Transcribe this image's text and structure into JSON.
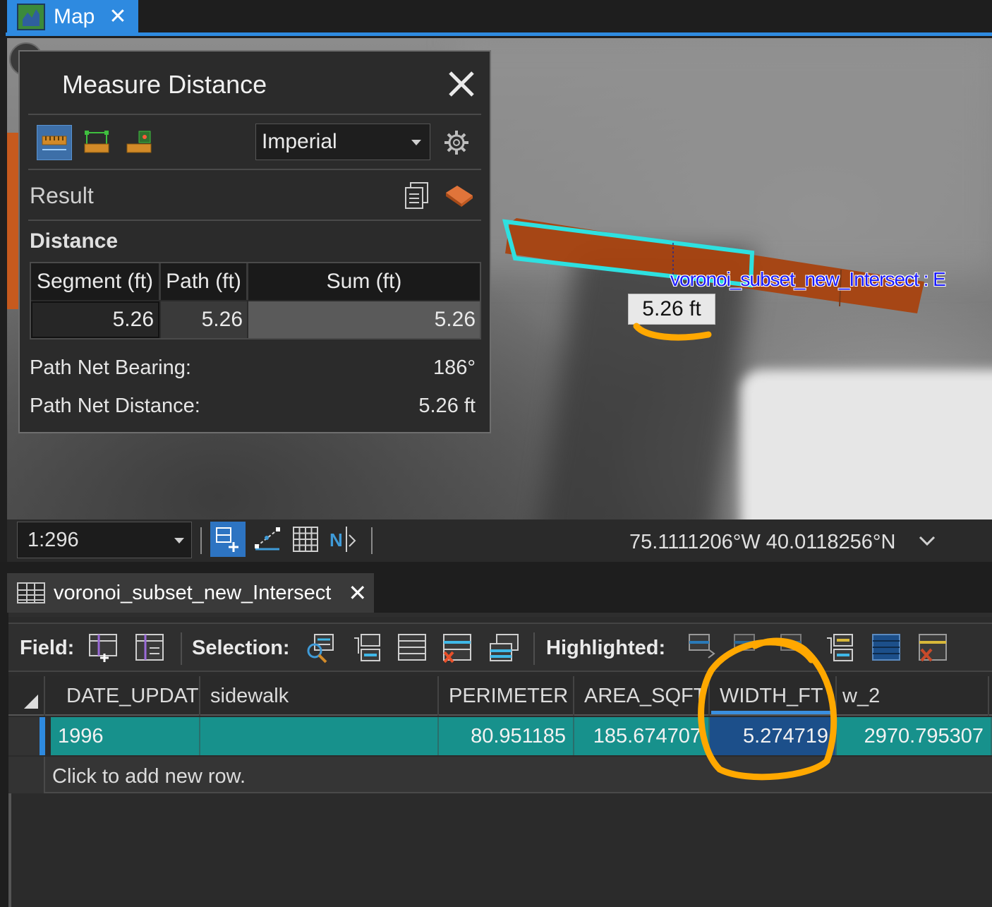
{
  "map_tab": {
    "label": "Map",
    "close": "✕"
  },
  "map": {
    "layer_label": "voronoi_subset_new_Intersect : E",
    "measure_label": "5.26 ft"
  },
  "measure_panel": {
    "title": "Measure Distance",
    "unit_select": "Imperial",
    "result_label": "Result",
    "distance_label": "Distance",
    "table": {
      "headers": [
        "Segment (ft)",
        "Path (ft)",
        "Sum (ft)"
      ],
      "values": [
        "5.26",
        "5.26",
        "5.26"
      ]
    },
    "path_net_bearing": {
      "label": "Path Net Bearing:",
      "value": "186°"
    },
    "path_net_distance": {
      "label": "Path Net Distance:",
      "value": "5.26 ft"
    }
  },
  "status_bar": {
    "scale": "1:296",
    "coordinates": "75.1111206°W 40.0118256°N"
  },
  "attribute_table": {
    "tab_label": "voronoi_subset_new_Intersect",
    "close": "✕",
    "toolbar": {
      "field_label": "Field:",
      "selection_label": "Selection:",
      "highlighted_label": "Highlighted:"
    },
    "columns": [
      "DATE_UPDAT",
      "sidewalk",
      "PERIMETER",
      "AREA_SQFT",
      "WIDTH_FT",
      "w_2"
    ],
    "row": [
      "1996",
      "",
      "80.951185",
      "185.674707",
      "5.274719",
      "2970.795307"
    ],
    "new_row_text": "Click to add new row."
  },
  "colors": {
    "accent": "#2e8ae0",
    "selected_row": "#17918c",
    "focused_cell": "#1c4f8a",
    "feature_fill": "#a8420f",
    "feature_outline": "#2ee0e0",
    "annotation": "#ffa800"
  }
}
